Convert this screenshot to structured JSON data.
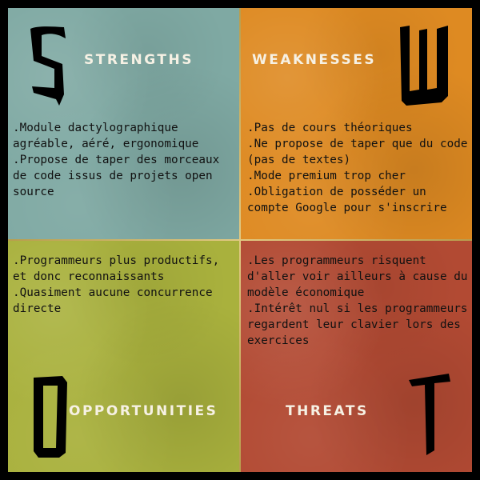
{
  "swot": {
    "strengths": {
      "letter": "S",
      "title": "STRENGTHS",
      "items": [
        ".Module dactylographique agréable, aéré, ergonomique",
        ".Propose de taper des morceaux de code issus de projets open source"
      ]
    },
    "weaknesses": {
      "letter": "W",
      "title": "WEAKNESSES",
      "items": [
        ".Pas de cours théoriques",
        ".Ne propose de taper que du code (pas de textes)",
        ".Mode premium trop cher",
        ".Obligation de posséder un compte Google pour s'inscrire"
      ]
    },
    "opportunities": {
      "letter": "O",
      "title": "OPPORTUNITIES",
      "items": [
        ".Programmeurs plus productifs, et donc reconnaissants",
        ".Quasiment aucune concurrence directe"
      ]
    },
    "threats": {
      "letter": "T",
      "title": "THREATS",
      "items": [
        ".Les programmeurs risquent d'aller voir ailleurs à cause du modèle économique",
        ".Intérêt nul si les programmeurs regardent leur clavier lors des exercices"
      ]
    }
  },
  "colors": {
    "strengths_bg": "#7fa9a3",
    "weaknesses_bg": "#de8a22",
    "opportunities_bg": "#a9b13d",
    "threats_bg": "#b24a33",
    "heading_text": "#f6f1e4",
    "body_text": "#111111",
    "divider": "#d4bd72"
  }
}
